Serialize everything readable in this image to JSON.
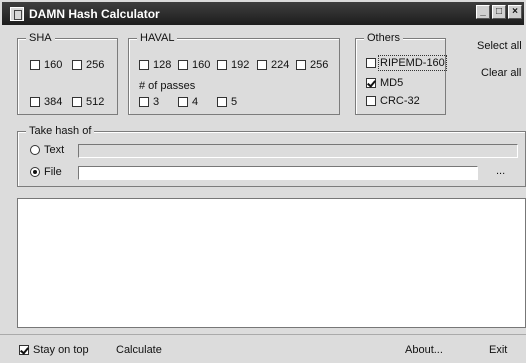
{
  "window": {
    "title": "DAMN Hash Calculator",
    "controls": {
      "minimize": "_",
      "maximize": "□",
      "close": "×"
    }
  },
  "sha": {
    "legend": "SHA",
    "options": [
      {
        "label": "160",
        "checked": false
      },
      {
        "label": "256",
        "checked": false
      },
      {
        "label": "384",
        "checked": false
      },
      {
        "label": "512",
        "checked": false
      }
    ]
  },
  "haval": {
    "legend": "HAVAL",
    "options": [
      {
        "label": "128",
        "checked": false
      },
      {
        "label": "160",
        "checked": false
      },
      {
        "label": "192",
        "checked": false
      },
      {
        "label": "224",
        "checked": false
      },
      {
        "label": "256",
        "checked": false
      }
    ],
    "passes_label": "# of passes",
    "passes": [
      {
        "label": "3",
        "checked": false
      },
      {
        "label": "4",
        "checked": false
      },
      {
        "label": "5",
        "checked": false
      }
    ]
  },
  "others": {
    "legend": "Others",
    "options": [
      {
        "label": "RIPEMD-160",
        "checked": false
      },
      {
        "label": "MD5",
        "checked": true
      },
      {
        "label": "CRC-32",
        "checked": false
      }
    ]
  },
  "actions": {
    "select_all": "Select all",
    "clear_all": "Clear all"
  },
  "take_hash": {
    "legend": "Take hash of",
    "text_label": "Text",
    "file_label": "File",
    "selected": "File",
    "text_value": "",
    "file_value": "",
    "browse_label": "..."
  },
  "footer": {
    "stay_on_top": "Stay on top",
    "stay_on_top_checked": true,
    "calculate": "Calculate",
    "about": "About...",
    "exit": "Exit"
  }
}
